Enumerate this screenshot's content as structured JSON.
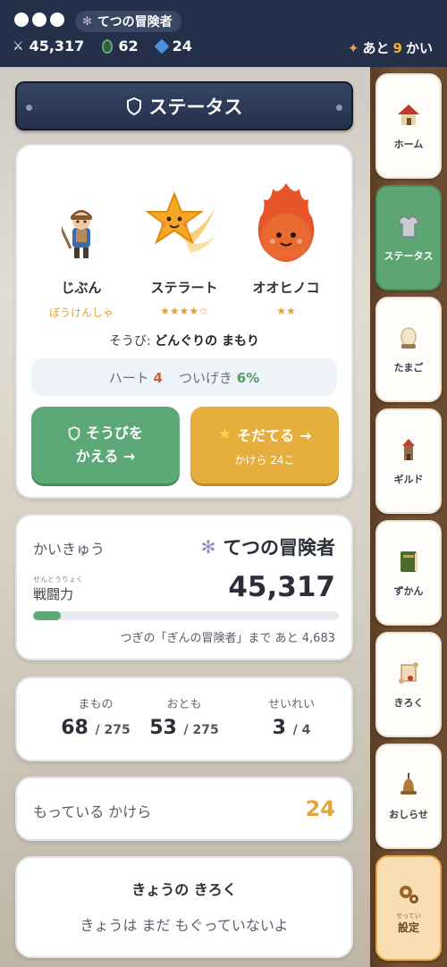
{
  "topbar": {
    "title": "てつの冒険者",
    "coins": "45,317",
    "green_gems": "62",
    "blue_gems": "24",
    "remaining_prefix": "あと",
    "remaining_count": "9",
    "remaining_suffix": "かい"
  },
  "header": {
    "title": "ステータス"
  },
  "characters": [
    {
      "name": "じぶん",
      "sub": "ぼうけんしゃ"
    },
    {
      "name": "ステラート",
      "sub": "★★★★☆"
    },
    {
      "name": "オオヒノコ",
      "sub": "★★"
    }
  ],
  "equip": {
    "prefix": "そうび:",
    "item": "どんぐりの まもり"
  },
  "info": {
    "heart_label": "ハート",
    "heart_value": "4",
    "chase_label": "ついげき",
    "chase_value": "6%"
  },
  "buttons": {
    "equip_line1": "そうびを",
    "equip_line2": "かえる →",
    "grow_label": "そだてる →",
    "grow_sub": "かけら 24こ"
  },
  "rank": {
    "label": "かいきゅう",
    "name": "てつの冒険者",
    "power_ruby": "せんとうりょく",
    "power_label": "戦闘力",
    "power_value": "45,317",
    "progress": 0.09,
    "next_text": "つぎの「ぎんの冒険者」まで あと 4,683"
  },
  "counts": [
    {
      "label": "まもの",
      "value": "68",
      "total": "/ 275"
    },
    {
      "label": "おとも",
      "value": "53",
      "total": "/ 275"
    },
    {
      "label": "せいれい",
      "value": "3",
      "total": "/ 4"
    }
  ],
  "fragments": {
    "label": "もっている かけら",
    "value": "24"
  },
  "log": {
    "title": "きょうの きろく",
    "body": "きょうは まだ もぐっていないよ"
  },
  "nav": [
    {
      "label": "ホーム"
    },
    {
      "label": "ステータス"
    },
    {
      "label": "たまご"
    },
    {
      "label": "ギルド"
    },
    {
      "label": "ずかん"
    },
    {
      "label": "きろく"
    },
    {
      "label": "おしらせ"
    },
    {
      "label": "設定",
      "ruby": "せってい"
    }
  ],
  "colors": {
    "accent_green": "#5ca876",
    "accent_orange": "#e5ae3d",
    "navy": "#243049"
  }
}
